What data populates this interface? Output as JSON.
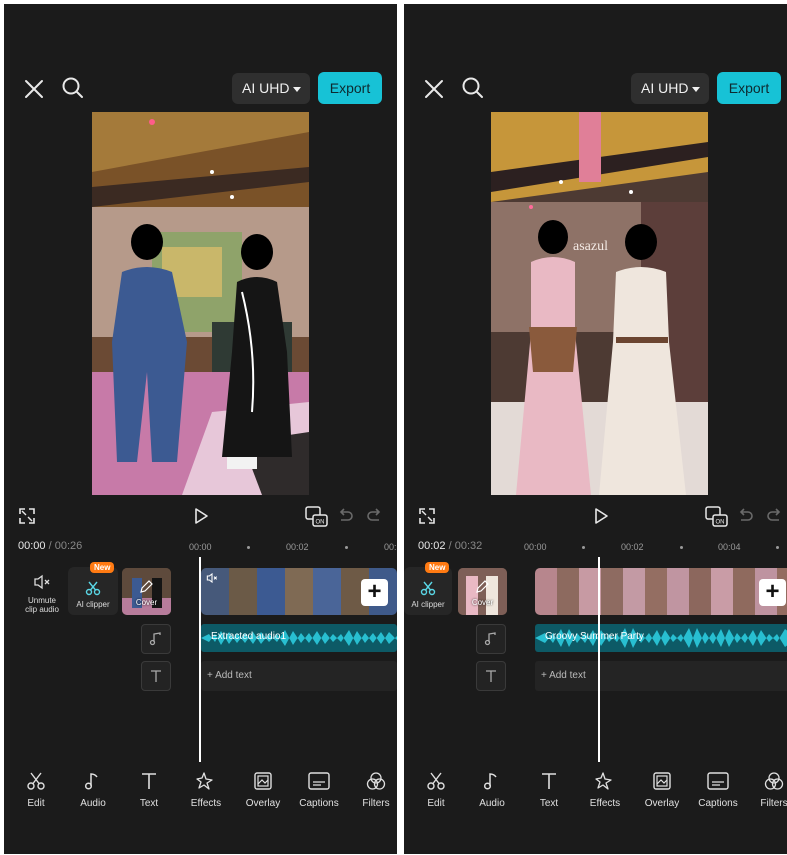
{
  "screens": [
    {
      "header": {
        "quality_label": "AI UHD",
        "export_label": "Export"
      },
      "player": {
        "onoff_label": "ON"
      },
      "timecode": {
        "current": "00:00",
        "separator": "/",
        "total": "00:26"
      },
      "ruler": [
        "00:00",
        "00:02",
        "00:"
      ],
      "side_tools": {
        "unmute_label": "Unmute clip audio",
        "ai_clipper_label": "AI clipper",
        "new_badge": "New",
        "cover_label": "Cover"
      },
      "audio_track": {
        "name": "Extracted audio1"
      },
      "text_track": {
        "add_text_label": "+ Add text"
      },
      "toolbar": [
        "Edit",
        "Audio",
        "Text",
        "Effects",
        "Overlay",
        "Captions",
        "Filters"
      ]
    },
    {
      "header": {
        "quality_label": "AI UHD",
        "export_label": "Export"
      },
      "player": {
        "onoff_label": "ON"
      },
      "timecode": {
        "current": "00:02",
        "separator": "/",
        "total": "00:32"
      },
      "ruler": [
        "00:00",
        "00:02",
        "00:04"
      ],
      "side_tools": {
        "ai_clipper_label": "AI clipper",
        "new_badge": "New",
        "cover_label": "Cover"
      },
      "audio_track": {
        "name": "Groovy Summer Party"
      },
      "text_track": {
        "add_text_label": "+ Add text"
      },
      "preview_sign": "asazul",
      "toolbar": [
        "Edit",
        "Audio",
        "Text",
        "Effects",
        "Overlay",
        "Captions",
        "Filters"
      ]
    }
  ],
  "colors": {
    "accent": "#17c2d6",
    "badge": "#ff7a12",
    "background": "#1b1b1b",
    "audio_track": "#0d5a66"
  },
  "icons": [
    "close-icon",
    "search-icon",
    "fullscreen-icon",
    "play-icon",
    "preview-onoff-icon",
    "undo-icon",
    "redo-icon",
    "mute-icon",
    "scissors-icon",
    "pencil-icon",
    "music-note-icon",
    "text-icon",
    "effects-icon",
    "overlay-icon",
    "captions-icon",
    "filters-icon"
  ]
}
